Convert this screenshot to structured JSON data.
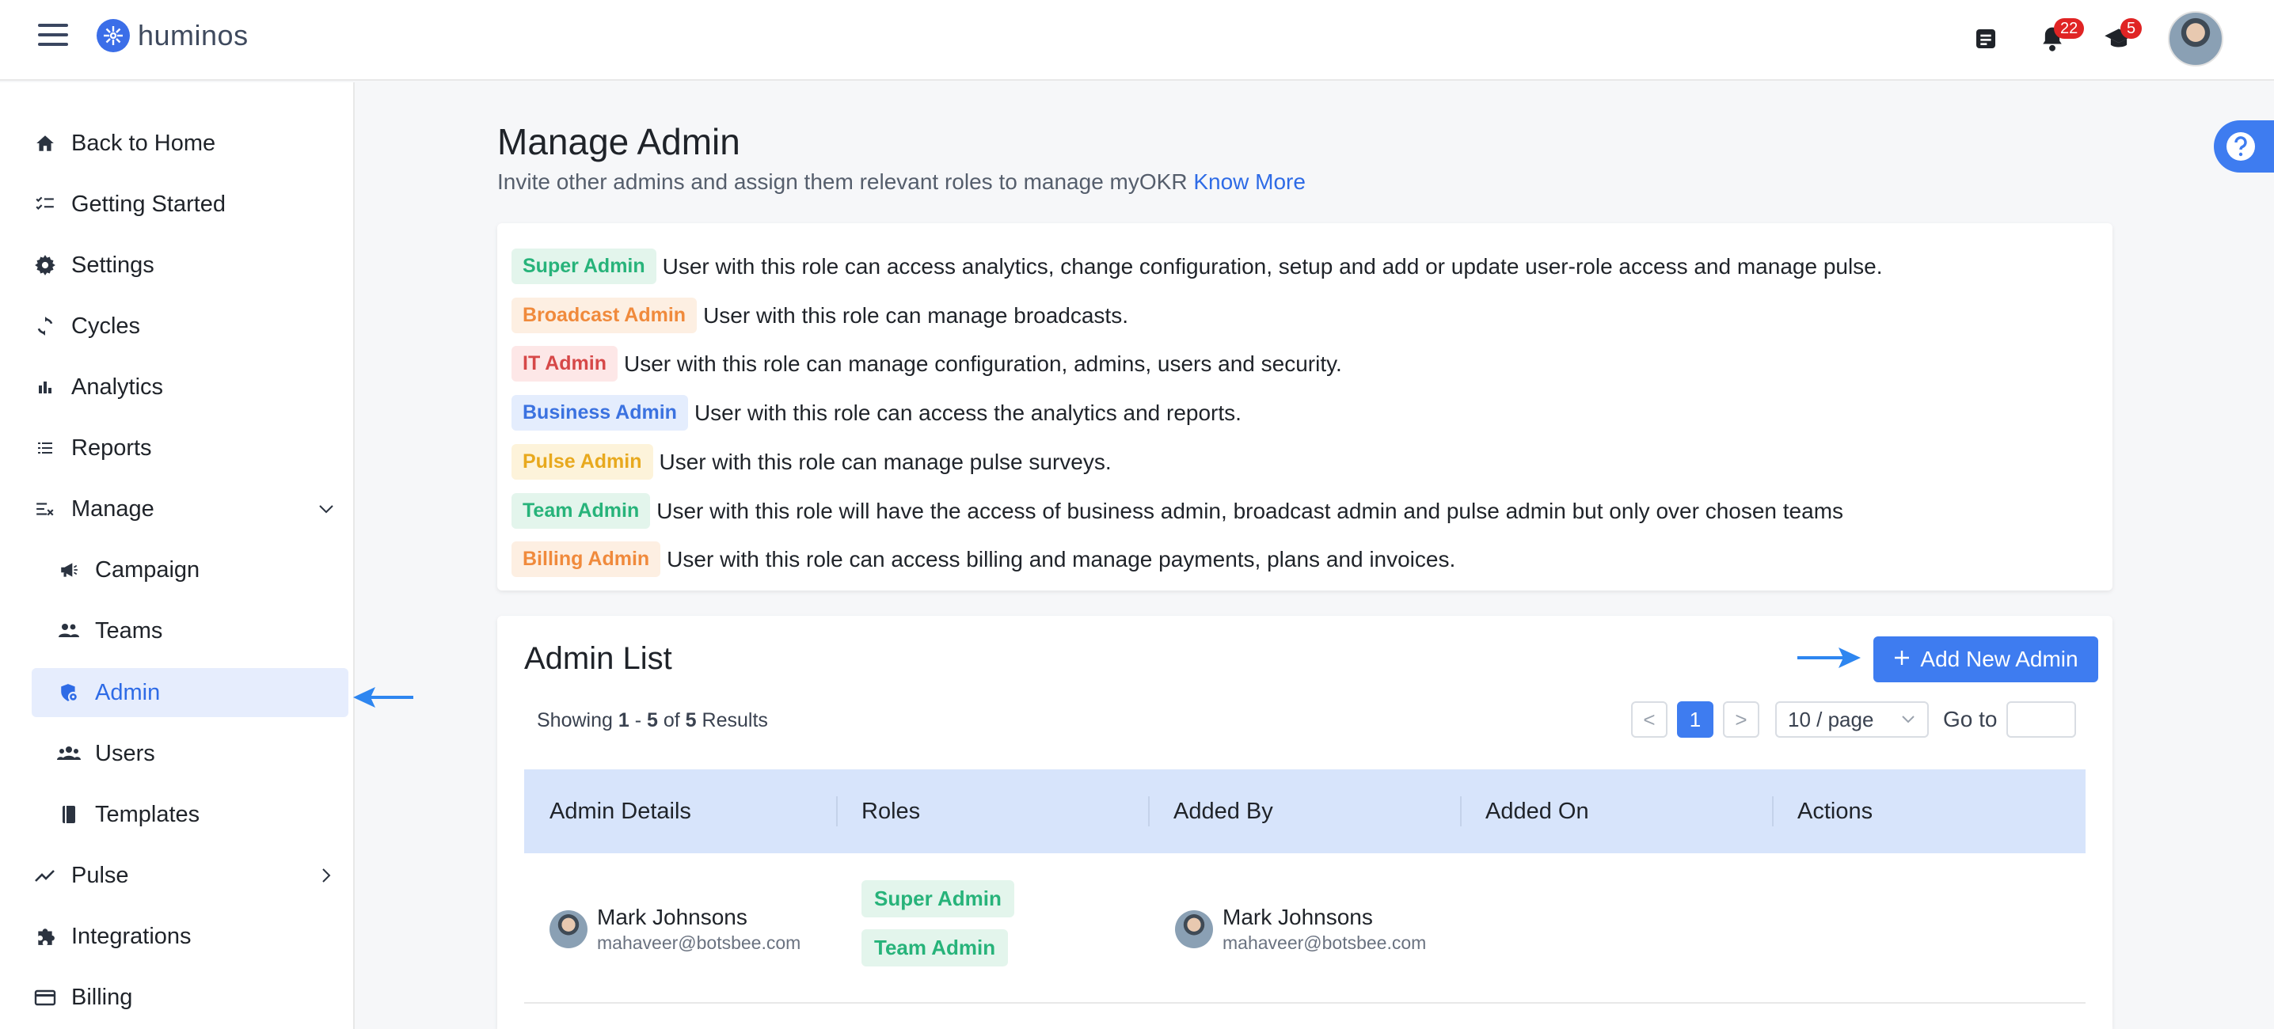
{
  "brand": {
    "name": "huminos"
  },
  "header": {
    "notifications_count": "22",
    "learning_count": "5"
  },
  "sidebar": {
    "items": [
      {
        "label": "Back to Home",
        "icon": "home-icon"
      },
      {
        "label": "Getting Started",
        "icon": "checklist-icon"
      },
      {
        "label": "Settings",
        "icon": "gear-icon"
      },
      {
        "label": "Cycles",
        "icon": "sync-icon"
      },
      {
        "label": "Analytics",
        "icon": "bar-chart-icon"
      },
      {
        "label": "Reports",
        "icon": "list-icon"
      },
      {
        "label": "Manage",
        "icon": "manage-icon",
        "expanded": true
      },
      {
        "label": "Campaign",
        "icon": "megaphone-icon"
      },
      {
        "label": "Teams",
        "icon": "team-icon"
      },
      {
        "label": "Admin",
        "icon": "admin-shield-icon",
        "active": true
      },
      {
        "label": "Users",
        "icon": "users-icon"
      },
      {
        "label": "Templates",
        "icon": "book-icon"
      },
      {
        "label": "Pulse",
        "icon": "trend-icon"
      },
      {
        "label": "Integrations",
        "icon": "puzzle-icon"
      },
      {
        "label": "Billing",
        "icon": "card-icon"
      }
    ]
  },
  "main": {
    "title": "Manage Admin",
    "subtitle": "Invite other admins and assign them relevant roles to manage myOKR",
    "know_more": "Know More",
    "roles": [
      {
        "tag": "Super Admin",
        "color": "green",
        "desc": "User with this role can access analytics, change configuration, setup and add or update user-role access and manage pulse."
      },
      {
        "tag": "Broadcast Admin",
        "color": "orange",
        "desc": "User with this role can manage broadcasts."
      },
      {
        "tag": "IT Admin",
        "color": "red",
        "desc": "User with this role can manage configuration, admins, users and security."
      },
      {
        "tag": "Business Admin",
        "color": "blue",
        "desc": "User with this role can access the analytics and reports."
      },
      {
        "tag": "Pulse Admin",
        "color": "yellow",
        "desc": "User with this role can manage pulse surveys."
      },
      {
        "tag": "Team Admin",
        "color": "green",
        "desc": "User with this role will have the access of business admin, broadcast admin and pulse admin but only over chosen teams"
      },
      {
        "tag": "Billing Admin",
        "color": "orange",
        "desc": "User with this role can access billing and manage payments, plans and invoices."
      }
    ]
  },
  "admin_list": {
    "title": "Admin List",
    "add_button": "Add New Admin",
    "showing_prefix": "Showing",
    "showing_from": "1",
    "showing_dash": "-",
    "showing_to": "5",
    "showing_of": "of",
    "showing_total": "5",
    "showing_suffix": "Results",
    "pagination": {
      "prev": "<",
      "current": "1",
      "next": ">",
      "page_size": "10 / page",
      "goto_label": "Go to",
      "goto_value": ""
    },
    "columns": [
      "Admin Details",
      "Roles",
      "Added By",
      "Added On",
      "Actions"
    ],
    "rows": [
      {
        "name": "Mark Johnsons",
        "email": "mahaveer@botsbee.com",
        "roles": [
          "Super Admin",
          "Team Admin"
        ],
        "added_by_name": "Mark Johnsons",
        "added_by_email": "mahaveer@botsbee.com",
        "added_on": "",
        "actions": ""
      }
    ]
  },
  "colors": {
    "accent": "#3e7cf0",
    "header_row": "#d7e4fb",
    "active_nav_bg": "#e6edfd"
  }
}
